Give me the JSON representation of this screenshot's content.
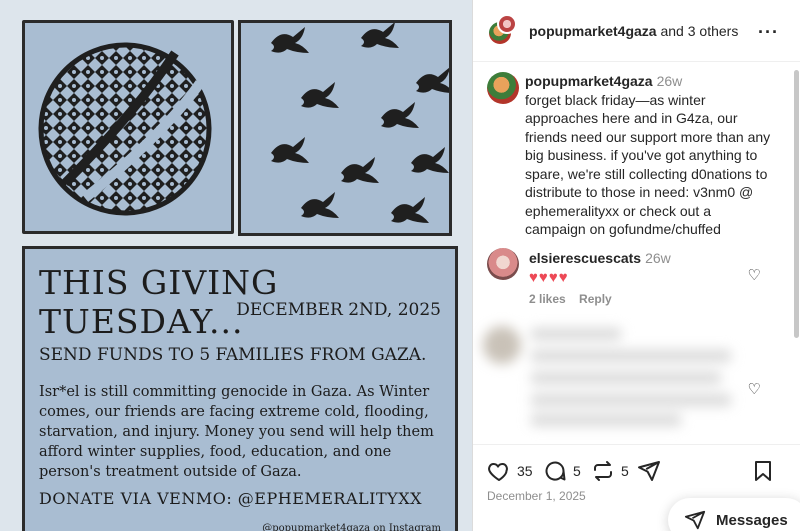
{
  "poster": {
    "title": "THIS GIVING TUESDAY...",
    "date": "DECEMBER 2ND, 2025",
    "subtitle": "SEND FUNDS TO 5 FAMILIES FROM GAZA.",
    "body": "Isr*el is still committing genocide in Gaza. As Winter comes, our friends are facing extreme cold, flooding, starvation, and injury. Money you send will help them afford winter supplies, food, education, and one person's treatment outside of Gaza.",
    "donate": "DONATE VIA VENMO:  @EPHEMERALITYXX",
    "footer": "@popupmarket4gaza on Instagram"
  },
  "header": {
    "username": "popupmarket4gaza",
    "others": " and 3 others",
    "more_icon": "more-horizontal-icon"
  },
  "caption": {
    "username": "popupmarket4gaza",
    "time": "26w",
    "text": "forget black friday—as winter approaches here and in G4za, our friends need our support more than any big business. if you've got anything to spare, we're still collecting d0nations to distribute to those in need: v3nm0 @ ephemeralityxx or check out a campaign on gofundme/chuffed"
  },
  "comment": {
    "username": "elsierescuescats",
    "time": "26w",
    "text": "♥♥♥♥",
    "likes": "2 likes",
    "reply": "Reply"
  },
  "actions": {
    "likes": "35",
    "comments": "5",
    "shares": "5",
    "date": "December 1, 2025"
  },
  "messages": {
    "label": "Messages"
  }
}
